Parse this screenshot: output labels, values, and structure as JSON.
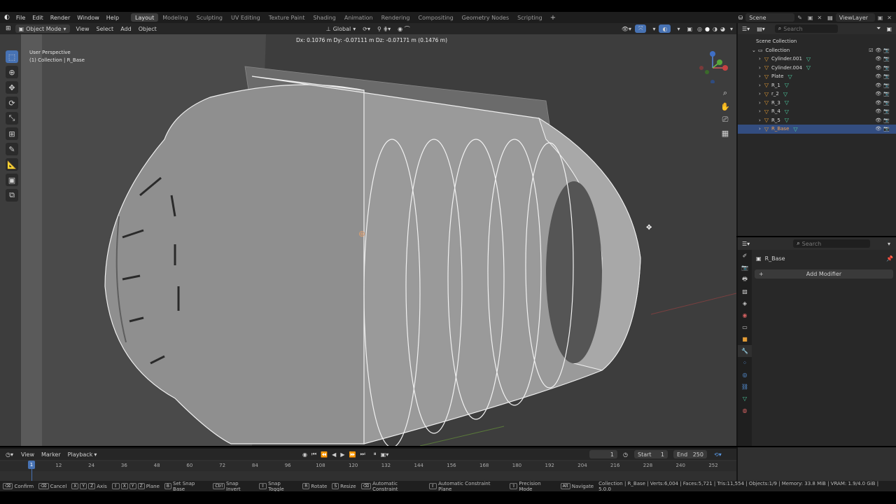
{
  "menus": [
    "File",
    "Edit",
    "Render",
    "Window",
    "Help"
  ],
  "workspaces": [
    "Layout",
    "Modeling",
    "Sculpting",
    "UV Editing",
    "Texture Paint",
    "Shading",
    "Animation",
    "Rendering",
    "Compositing",
    "Geometry Nodes",
    "Scripting"
  ],
  "active_workspace": "Layout",
  "scene": "Scene",
  "view_layer": "ViewLayer",
  "viewport": {
    "mode": "Object Mode",
    "menus": [
      "View",
      "Select",
      "Add",
      "Object"
    ],
    "orientation": "Global",
    "perspective": "User Perspective",
    "active_info": "(1) Collection | R_Base",
    "transform_readout": "Dx: 0.1076 m   Dy: -0.07111 m   Dz: -0.07171 m (0.1476 m)"
  },
  "outliner": {
    "search_placeholder": "Search",
    "root": "Scene Collection",
    "collection": "Collection",
    "items": [
      "Cylinder.001",
      "Cylinder.004",
      "Plate",
      "R_1",
      "r_2",
      "R_3",
      "R_4",
      "R_5",
      "R_Base"
    ],
    "selected": "R_Base"
  },
  "properties": {
    "search_placeholder": "Search",
    "object_name": "R_Base",
    "add_modifier": "Add Modifier"
  },
  "timeline": {
    "menus": [
      "View",
      "Marker",
      "Playback"
    ],
    "current_frame": "1",
    "start_label": "Start",
    "start": "1",
    "end_label": "End",
    "end": "250",
    "ticks": [
      "12",
      "24",
      "36",
      "48",
      "60",
      "72",
      "84",
      "96",
      "108",
      "120",
      "132",
      "144",
      "156",
      "168",
      "180",
      "192",
      "204",
      "216",
      "228",
      "240",
      "252"
    ],
    "playhead": "1"
  },
  "status": {
    "hints": [
      {
        "keys": [
          "⌫"
        ],
        "label": "Confirm"
      },
      {
        "keys": [
          "⌫"
        ],
        "label": "Cancel"
      },
      {
        "keys": [
          "X",
          "Y",
          "Z"
        ],
        "label": "Axis"
      },
      {
        "keys": [
          "⇧",
          "X",
          "Y",
          "Z"
        ],
        "label": "Plane"
      },
      {
        "keys": [
          "B"
        ],
        "label": "Set Snap Base"
      },
      {
        "keys": [
          "Ctrl"
        ],
        "label": "Snap Invert"
      },
      {
        "keys": [
          "⇧"
        ],
        "label": "Snap Toggle"
      },
      {
        "keys": [
          "R"
        ],
        "label": "Rotate"
      },
      {
        "keys": [
          "S"
        ],
        "label": "Resize"
      },
      {
        "keys": [
          "⌫"
        ],
        "label": "Automatic Constraint"
      },
      {
        "keys": [
          "⇧"
        ],
        "label": "Automatic Constraint Plane"
      },
      {
        "keys": [
          "⇧"
        ],
        "label": "Precision Mode"
      },
      {
        "keys": [
          "Alt"
        ],
        "label": "Navigate"
      }
    ],
    "stats": "Collection | R_Base | Verts:6,004 | Faces:5,721 | Tris:11,554 | Objects:1/9 | Memory: 33.8 MiB | VRAM: 1.9/4.0 GiB | 5.0.0"
  },
  "colors": {
    "accent": "#4772b3",
    "object_icon": "#e29b35",
    "mesh_icon": "#4fd1a5",
    "selected_row": "#334d80"
  }
}
